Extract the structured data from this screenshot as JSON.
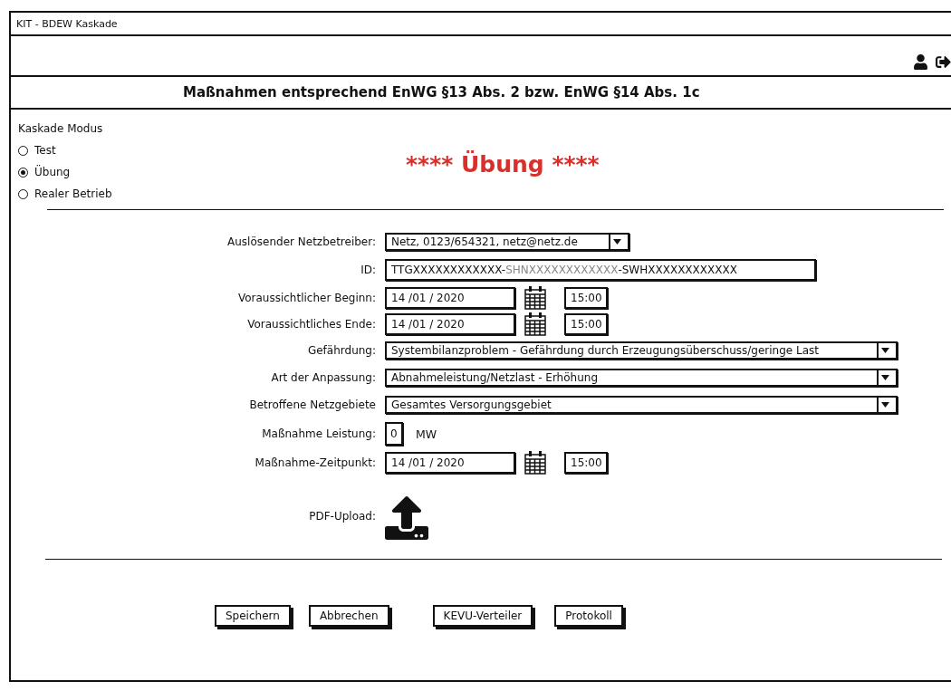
{
  "window": {
    "title": "KIT - BDEW Kaskade"
  },
  "header": {
    "title": "Maßnahmen entsprechend EnWG §13 Abs. 2 bzw. EnWG §14 Abs. 1c"
  },
  "mode": {
    "label": "Kaskade Modus",
    "options": [
      {
        "label": "Test",
        "selected": false
      },
      {
        "label": "Übung",
        "selected": true
      },
      {
        "label": "Realer Betrieb",
        "selected": false
      }
    ],
    "banner": "**** Übung ****"
  },
  "form": [
    {
      "kind": "short-select",
      "label": "Auslösender Netzbetreiber:",
      "value": "Netz, 0123/654321, netz@netz.de"
    },
    {
      "kind": "id",
      "label": "ID:",
      "segments": [
        {
          "text": "TTGXXXXXXXXXXXX-",
          "dimmed": false
        },
        {
          "text": "SHNXXXXXXXXXXXX",
          "dimmed": true
        },
        {
          "text": "-SWHXXXXXXXXXXXX",
          "dimmed": false
        }
      ]
    },
    {
      "kind": "datetime",
      "label": "Voraussichtlicher Beginn:",
      "date": "14 /01 / 2020",
      "time": "15:00"
    },
    {
      "kind": "datetime",
      "label": "Voraussichtliches Ende:",
      "date": "14 /01 / 2020",
      "time": "15:00"
    },
    {
      "kind": "select",
      "label": "Gefährdung:",
      "value": "Systembilanzproblem - Gefährdung durch Erzeugungsüberschuss/geringe Last"
    },
    {
      "kind": "select",
      "label": "Art der Anpassung:",
      "value": "Abnahmeleistung/Netzlast - Erhöhung"
    },
    {
      "kind": "select",
      "label": "Betroffene Netzgebiete",
      "value": "Gesamtes Versorgungsgebiet"
    },
    {
      "kind": "number",
      "label": "Maßnahme Leistung:",
      "value": "0",
      "unit": "MW"
    },
    {
      "kind": "datetime",
      "label": "Maßnahme-Zeitpunkt:",
      "date": "14 /01 / 2020",
      "time": "15:00"
    },
    {
      "kind": "upload",
      "label": "PDF-Upload:"
    }
  ],
  "buttons": [
    {
      "label": "Speichern"
    },
    {
      "label": "Abbrechen"
    },
    {
      "label": "KEVU-Verteiler"
    },
    {
      "label": "Protokoll"
    }
  ]
}
